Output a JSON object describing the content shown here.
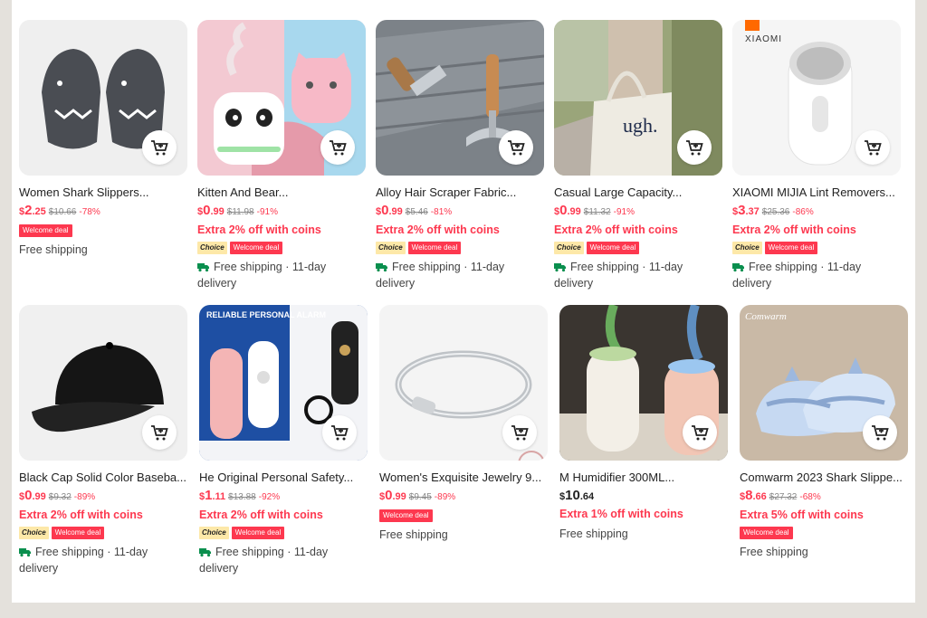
{
  "products": [
    {
      "title": "Women Shark Slippers...",
      "currency": "$",
      "price_int": "2",
      "price_dec": ".25",
      "original": "$10.66",
      "discount": "-78%",
      "extra": "",
      "choice": "",
      "welcome": "Welcome deal",
      "shipping": "Free shipping",
      "delivery": "",
      "art": "slippers"
    },
    {
      "title": "Kitten And Bear...",
      "currency": "$",
      "price_int": "0",
      "price_dec": ".99",
      "original": "$11.98",
      "discount": "-91%",
      "extra": "Extra 2% off with coins",
      "choice": "Choice",
      "welcome": "Welcome deal",
      "shipping": "Free shipping · 11-day",
      "delivery": "delivery",
      "art": "humidifier-pink"
    },
    {
      "title": "Alloy Hair Scraper Fabric...",
      "currency": "$",
      "price_int": "0",
      "price_dec": ".99",
      "original": "$5.46",
      "discount": "-81%",
      "extra": "Extra 2% off with coins",
      "choice": "Choice",
      "welcome": "Welcome deal",
      "shipping": "Free shipping · 11-day",
      "delivery": "delivery",
      "art": "scraper"
    },
    {
      "title": "Casual Large Capacity...",
      "currency": "$",
      "price_int": "0",
      "price_dec": ".99",
      "original": "$11.32",
      "discount": "-91%",
      "extra": "Extra 2% off with coins",
      "choice": "Choice",
      "welcome": "Welcome deal",
      "shipping": "Free shipping · 11-day",
      "delivery": "delivery",
      "art": "tote",
      "bag_text": "ugh."
    },
    {
      "title": "XIAOMI MIJIA Lint Removers...",
      "currency": "$",
      "price_int": "3",
      "price_dec": ".37",
      "original": "$25.36",
      "discount": "-86%",
      "extra": "Extra 2% off with coins",
      "choice": "Choice",
      "welcome": "Welcome deal",
      "shipping": "Free shipping · 11-day",
      "delivery": "delivery",
      "art": "lint",
      "brand_text": "XIAOMI"
    },
    {
      "title": "Black Cap Solid Color Baseba...",
      "currency": "$",
      "price_int": "0",
      "price_dec": ".99",
      "original": "$9.32",
      "discount": "-89%",
      "extra": "Extra 2% off with coins",
      "choice": "Choice",
      "welcome": "Welcome deal",
      "shipping": "Free shipping · 11-day",
      "delivery": "delivery",
      "art": "cap"
    },
    {
      "title": "He Original Personal Safety...",
      "currency": "$",
      "price_int": "1",
      "price_dec": ".11",
      "original": "$13.88",
      "discount": "-92%",
      "extra": "Extra 2% off with coins",
      "choice": "Choice",
      "welcome": "Welcome deal",
      "shipping": "Free shipping · 11-day",
      "delivery": "delivery",
      "art": "alarm",
      "banner_text": "RELIABLE PERSONAL ALARM"
    },
    {
      "title": "Women's Exquisite Jewelry 9...",
      "currency": "$",
      "price_int": "0",
      "price_dec": ".99",
      "original": "$9.45",
      "discount": "-89%",
      "extra": "",
      "choice": "",
      "welcome": "Welcome deal",
      "shipping": "Free shipping",
      "delivery": "",
      "art": "bracelet"
    },
    {
      "title": "M Humidifier 300ML...",
      "currency": "$",
      "price_int": "10",
      "price_dec": ".64",
      "original": "",
      "discount": "",
      "extra": "Extra 1% off with coins",
      "choice": "",
      "welcome": "",
      "shipping": "Free shipping",
      "delivery": "",
      "art": "humidifier-dark",
      "black_price": true
    },
    {
      "title": "Comwarm 2023 Shark Slippe...",
      "currency": "$",
      "price_int": "8",
      "price_dec": ".66",
      "original": "$27.32",
      "discount": "-68%",
      "extra": "Extra 5% off with coins",
      "choice": "",
      "welcome": "Welcome deal",
      "shipping": "Free shipping",
      "delivery": "",
      "art": "shark-blue",
      "brand_text": "Comwarm"
    }
  ],
  "colors": {
    "accent": "#fd384f",
    "choice_bg": "#fde8a8",
    "truck": "#0a8f4e"
  },
  "icons": {
    "cart": "add-to-cart-icon",
    "truck": "truck-icon"
  }
}
